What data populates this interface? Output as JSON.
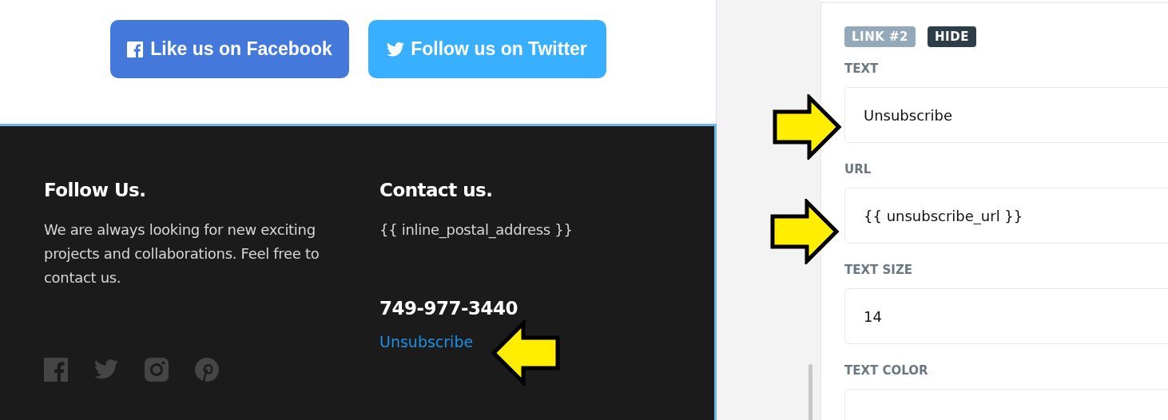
{
  "canvas": {
    "buttons": [
      {
        "kind": "facebook",
        "label": "Like us on Facebook"
      },
      {
        "kind": "twitter",
        "label": "Follow us on Twitter"
      }
    ],
    "footer": {
      "follow": {
        "heading": "Follow Us.",
        "text": "We are always looking for new exciting projects and collaborations. Feel free to contact us.",
        "social_icons": [
          {
            "kind": "facebook"
          },
          {
            "kind": "twitter"
          },
          {
            "kind": "instagram"
          },
          {
            "kind": "pinterest"
          }
        ]
      },
      "contact": {
        "heading": "Contact us.",
        "address": "{{ inline_postal_address }}",
        "phone": "749-977-3440",
        "link": "Unsubscribe"
      }
    }
  },
  "panel": {
    "badges": [
      {
        "kind": "label",
        "text": "LINK #2"
      },
      {
        "kind": "action",
        "text": "HIDE"
      }
    ],
    "fields": [
      {
        "label": "TEXT",
        "value": "Unsubscribe"
      },
      {
        "label": "URL",
        "value": "{{ unsubscribe_url }}"
      },
      {
        "label": "TEXT SIZE",
        "value": "14"
      },
      {
        "label": "TEXT COLOR"
      }
    ]
  },
  "annotations": [
    {
      "kind": "right_arrow"
    },
    {
      "kind": "right_arrow"
    },
    {
      "kind": "left_arrow"
    }
  ]
}
